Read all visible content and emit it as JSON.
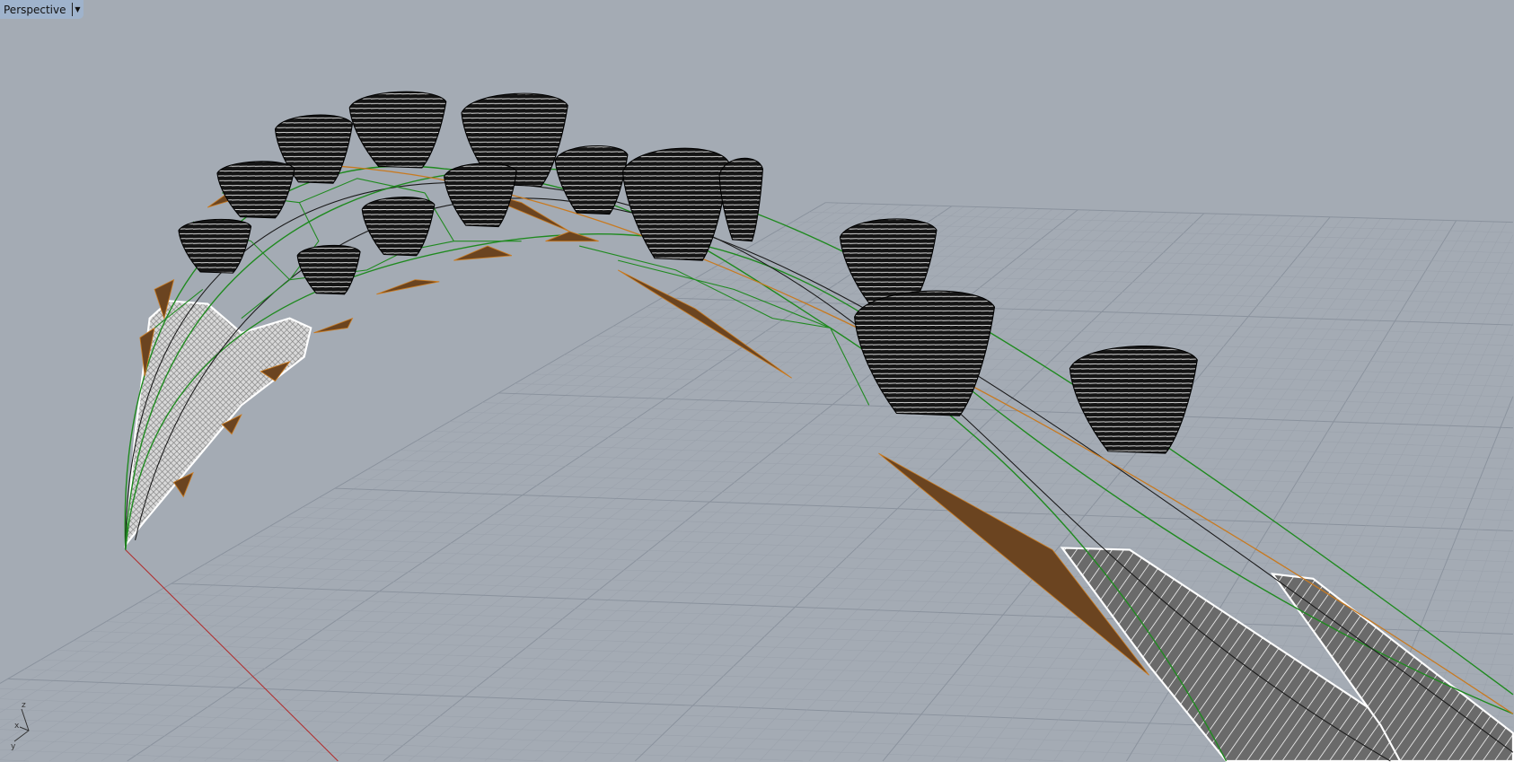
{
  "viewport": {
    "title": "Perspective",
    "menu_icon": "chevron-down-icon"
  },
  "axis_widget": {
    "z": "z",
    "x": "x",
    "y": "y"
  },
  "colors": {
    "background": "#a4abb4",
    "grid": "#98a0aa",
    "grid_major": "#8d95a0",
    "edge": "#1f8a1f",
    "panel": "#6b4420",
    "pod": "#151515",
    "x_axis": "#b03030"
  }
}
